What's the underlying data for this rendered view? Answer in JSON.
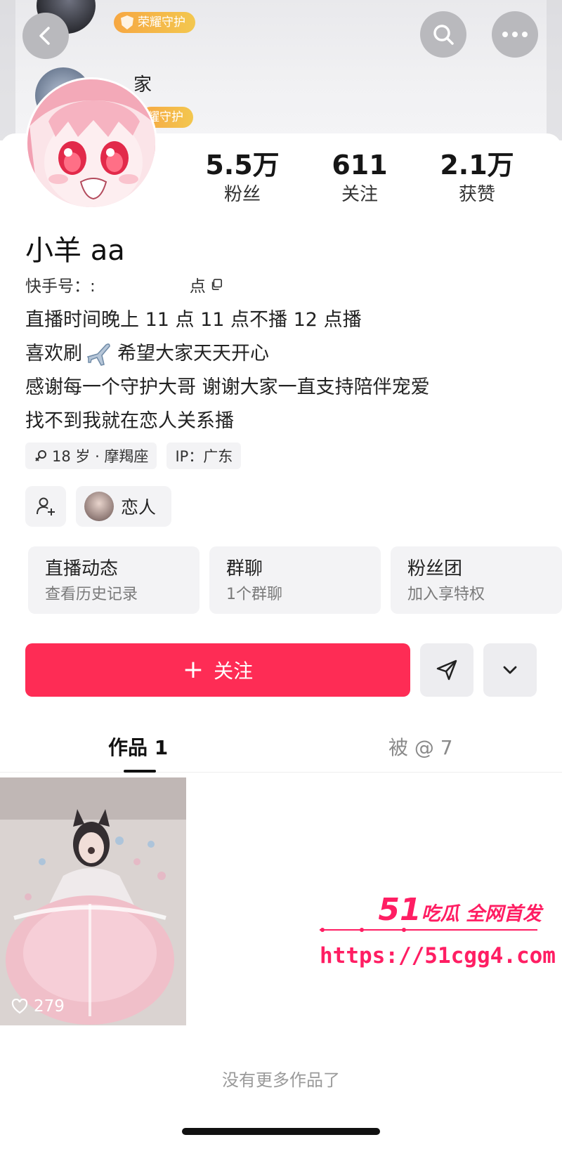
{
  "header": {
    "back_icon": "chevron-left-icon",
    "search_icon": "search-icon",
    "more_icon": "more-horizontal-icon",
    "banner_badge_top": "荣耀守护",
    "banner_badge_mid": "耀守护",
    "banner_word": "家",
    "badge_color": "#f6a742"
  },
  "profile": {
    "stats": [
      {
        "value": "5.5万",
        "label": "粉丝"
      },
      {
        "value": "611",
        "label": "关注"
      },
      {
        "value": "2.1万",
        "label": "获赞"
      }
    ],
    "name": "小羊 aa",
    "kuaishou_id_label": "快手号：:",
    "kuaishou_id_suffix": "点",
    "bio": [
      "直播时间晚上 11 点 11 点不播 12 点播",
      "喜欢刷",
      "希望大家天天开心",
      "感谢每一个守护大哥 谢谢大家一直支持陪伴宠爱",
      "找不到我就在恋人关系播"
    ],
    "tags": {
      "age_zodiac": "18 岁 · 摩羯座",
      "ip": "IP：广东"
    },
    "relation": {
      "add_icon": "add-user-icon",
      "lover_label": "恋人"
    }
  },
  "feature_cards": [
    {
      "title": "直播动态",
      "sub": "查看历史记录"
    },
    {
      "title": "群聊",
      "sub": "1个群聊"
    },
    {
      "title": "粉丝团",
      "sub": "加入享特权"
    }
  ],
  "actions": {
    "follow_plus": "+",
    "follow_label": "关注",
    "share_icon": "send-icon",
    "expand_icon": "chevron-down-icon",
    "accent_color": "#fe2c55"
  },
  "tabs": [
    {
      "label": "作品 1",
      "active": true
    },
    {
      "label": "被 @ 7",
      "active": false
    }
  ],
  "works": [
    {
      "likes": "279"
    }
  ],
  "watermark": {
    "big": "51",
    "text": "吃瓜 全网首发",
    "url": "https://51cgg4.com"
  },
  "footer": {
    "no_more": "没有更多作品了"
  }
}
